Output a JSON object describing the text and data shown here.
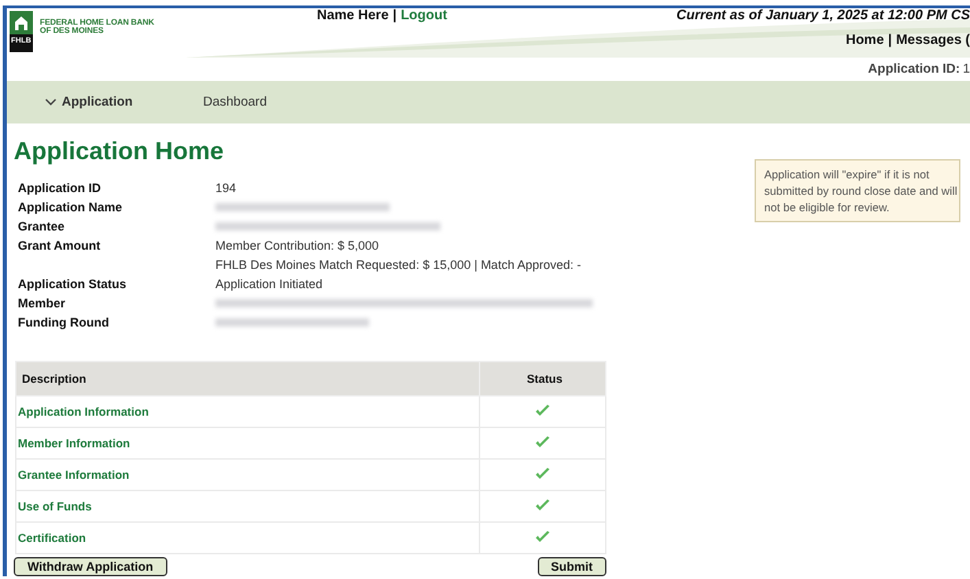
{
  "header": {
    "logo_mark": "FHLB",
    "logo_text": [
      "FEDERAL HOME LOAN BANK",
      "OF DES MOINES"
    ],
    "user": "Name Here",
    "separator": "|",
    "logout": "Logout",
    "current_as_of": "Current as of January 1, 2025 at 12:00 PM CS",
    "links": [
      {
        "label": "Home"
      },
      {
        "label": "Messages ("
      }
    ],
    "app_id_label": "Application ID:",
    "app_id_value": "1"
  },
  "nav": [
    {
      "label": "Application",
      "expanded": true
    },
    {
      "label": "Dashboard",
      "expanded": false
    }
  ],
  "title": "Application Home",
  "details": [
    {
      "label": "Application ID",
      "lines": [
        {
          "text": "194"
        }
      ]
    },
    {
      "label": "Application Name",
      "lines": [
        {
          "kind": "redacted"
        }
      ]
    },
    {
      "label": "Grantee",
      "lines": [
        {
          "kind": "redacted"
        }
      ]
    },
    {
      "label": "Grant Amount",
      "lines": [
        {
          "text": "Member Contribution: $ 5,000"
        },
        {
          "text": "FHLB Des Moines Match Requested: $ 15,000 | Match Approved: -"
        }
      ]
    },
    {
      "label": "Application Status",
      "lines": [
        {
          "text": "Application Initiated"
        }
      ]
    },
    {
      "label": "Member",
      "lines": [
        {
          "kind": "redacted"
        }
      ]
    },
    {
      "label": "Funding Round",
      "lines": [
        {
          "kind": "redacted"
        }
      ]
    }
  ],
  "notice": "Application will \"expire\" if it is not submitted by round close date and will not be eligible for review.",
  "table": {
    "columns": [
      "Description",
      "Status"
    ],
    "rows": [
      {
        "description": "Application Information",
        "complete": true
      },
      {
        "description": "Member Information",
        "complete": true
      },
      {
        "description": "Grantee Information",
        "complete": true
      },
      {
        "description": "Use of Funds",
        "complete": true
      },
      {
        "description": "Certification",
        "complete": true
      }
    ]
  },
  "buttons": [
    {
      "label": "Withdraw Application"
    },
    {
      "label": "Submit"
    }
  ]
}
